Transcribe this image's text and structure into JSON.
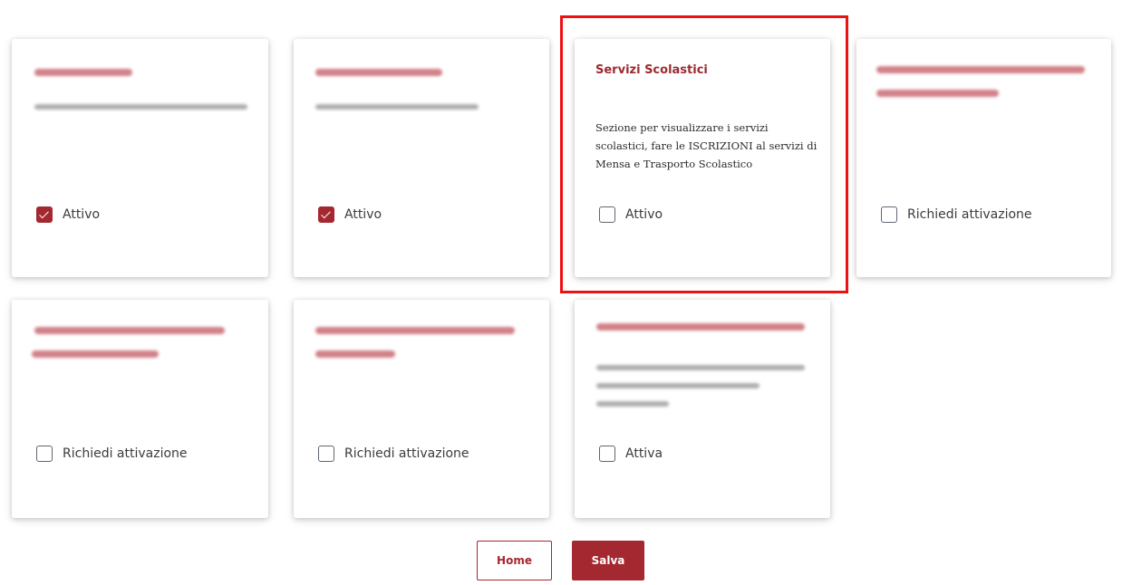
{
  "colors": {
    "accent": "#a4282f",
    "title": "#9c2a2f",
    "highlight": "#ee1111"
  },
  "cards": [
    {
      "checkbox_label": "Attivo",
      "checked": true
    },
    {
      "checkbox_label": "Attivo",
      "checked": true
    },
    {
      "title": "Servizi Scolastici",
      "description": "Sezione per visualizzare i servizi scolastici, fare le ISCRIZIONI al servizi di Mensa e Trasporto Scolastico",
      "checkbox_label": "Attivo",
      "checked": false
    },
    {
      "checkbox_label": "Richiedi attivazione",
      "checked": false
    },
    {
      "checkbox_label": "Richiedi attivazione",
      "checked": false
    },
    {
      "checkbox_label": "Richiedi attivazione",
      "checked": false
    },
    {
      "checkbox_label": "Attiva",
      "checked": false
    }
  ],
  "buttons": {
    "home": "Home",
    "save": "Salva"
  },
  "icons": {
    "checkbox_checked": "check-icon"
  }
}
